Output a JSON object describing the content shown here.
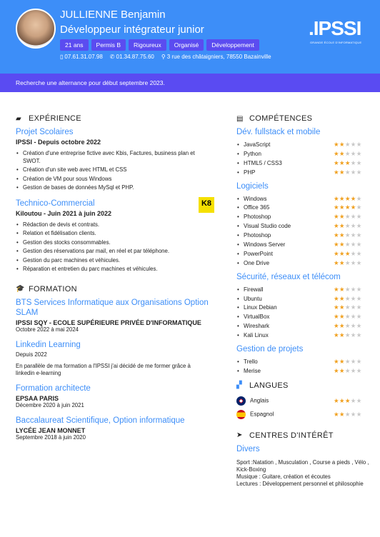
{
  "header": {
    "name": "JULLIENNE Benjamin",
    "job_title": "Développeur intégrateur junior",
    "badges": [
      "21 ans",
      "Permis B",
      "Rigoureux",
      "Organisé",
      "Développement"
    ],
    "phone1": "07.61.31.07.98",
    "phone2": "01.34.87.75.60",
    "address": "3 rue des châtaigniers, 78550 Bazainville",
    "logo": ".IPSSI",
    "logo_sub": "GRANDE ÉCOLE D'INFORMATIQUE"
  },
  "banner": "Recherche une alternance pour début septembre 2023.",
  "experience": {
    "title": "EXPÉRIENCE",
    "jobs": [
      {
        "role": "Projet Scolaires",
        "org": "IPSSI - Depuis octobre 2022",
        "items": [
          "Création d'une entreprise fictive avec Kbis, Factures, business plan et SWOT.",
          "Création d'un site web avec HTML et CSS",
          "Création de VM pour sous Windows",
          "Gestion de bases de données MySql et PHP."
        ]
      },
      {
        "role": "Technico-Commercial",
        "org": "Kiloutou - Juin 2021 à juin 2022",
        "logo": "K8",
        "items": [
          "Rédaction de devis et contrats.",
          "Relation et fidélisation clients.",
          "Gestion des stocks consommables.",
          "Gestion des réservations par mail, en réel et par téléphone.",
          "Gestion du parc machines et véhicules.",
          "Réparation et entretien du parc machines et véhicules."
        ]
      }
    ]
  },
  "formation": {
    "title": "FORMATION",
    "items": [
      {
        "title": "BTS Services Informatique aux Organisations Option SLAM",
        "school": "IPSSI SQY - ECOLE SUPÉRIEURE PRIVÉE D'INFORMATIQUE",
        "date": "Octobre 2022 à mai 2024"
      },
      {
        "title": "Linkedin Learning",
        "school": "Depuis 2022",
        "date": "En parallèle de ma formation a l'IPSSI j'ai décidé de me former grâce à linkedin e-learning"
      },
      {
        "title": "Formation architecte",
        "school": "EPSAA PARIS",
        "date": "Décembre 2020 à juin 2021"
      },
      {
        "title": "Baccalaureat Scientifique, Option informatique",
        "school": "LYCÉE JEAN MONNET",
        "date": "Septembre 2018 à juin 2020"
      }
    ]
  },
  "skills": {
    "title": "COMPÉTENCES",
    "groups": [
      {
        "title": "Dév. fullstack et mobile",
        "items": [
          {
            "name": "JavaScript",
            "level": 2
          },
          {
            "name": "Python",
            "level": 2
          },
          {
            "name": "HTML5 / CSS3",
            "level": 3
          },
          {
            "name": "PHP",
            "level": 2
          }
        ]
      },
      {
        "title": "Logiciels",
        "items": [
          {
            "name": "Windows",
            "level": 4
          },
          {
            "name": "Office 365",
            "level": 4
          },
          {
            "name": "Photoshop",
            "level": 2
          },
          {
            "name": "Visual Studio code",
            "level": 2
          },
          {
            "name": "Photoshop",
            "level": 2
          },
          {
            "name": "Windows Server",
            "level": 2
          },
          {
            "name": "PowerPoint",
            "level": 3
          },
          {
            "name": "One Drive",
            "level": 2
          }
        ]
      },
      {
        "title": "Sécurité, réseaux et télécom",
        "items": [
          {
            "name": "Firewall",
            "level": 2
          },
          {
            "name": "Ubuntu",
            "level": 2
          },
          {
            "name": "Linux Debian",
            "level": 2
          },
          {
            "name": "VirtualBox",
            "level": 2
          },
          {
            "name": "Wireshark",
            "level": 2
          },
          {
            "name": "Kali Linux",
            "level": 2
          }
        ]
      },
      {
        "title": "Gestion de projets",
        "items": [
          {
            "name": "Trello",
            "level": 2
          },
          {
            "name": "Merise",
            "level": 2
          }
        ]
      }
    ]
  },
  "languages": {
    "title": "LANGUES",
    "items": [
      {
        "name": "Anglais",
        "level": 3
      },
      {
        "name": "Espagnol",
        "level": 2
      }
    ]
  },
  "interests": {
    "title": "CENTRES D'INTÉRÊT",
    "subtitle": "Divers",
    "sport": "Sport :Natation , Musculation , Course a pieds , Vélo , Kick-Boxing",
    "music": "Musique : Guitare, création et écoutes",
    "reading": "Lectures : Développement personnel et philosophie"
  },
  "colors": {
    "primary": "#3d8ef8",
    "banner": "#5a4bf2",
    "star": "#f0a01f"
  }
}
